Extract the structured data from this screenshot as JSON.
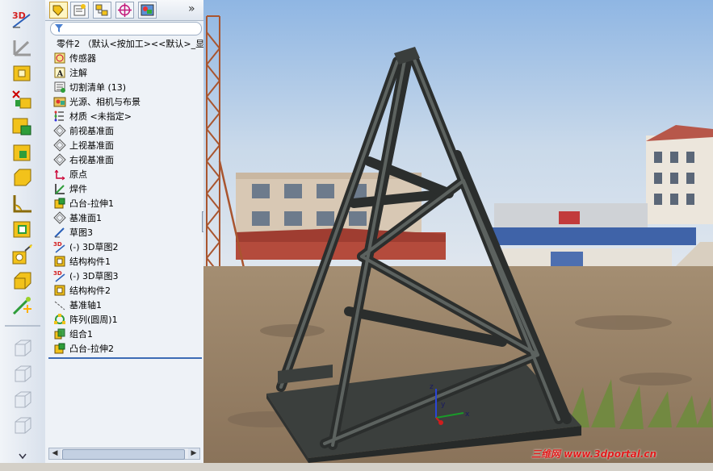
{
  "feature_tree": {
    "root": "零件2 （默认<按加工><<默认>_显",
    "items": [
      {
        "label": "传感器",
        "icon": "sensor-icon"
      },
      {
        "label": "注解",
        "icon": "annotation-icon"
      },
      {
        "label": "切割清单 (13)",
        "icon": "cut-list-icon"
      },
      {
        "label": "光源、相机与布景",
        "icon": "lights-camera-scene-icon"
      },
      {
        "label": "材质 <未指定>",
        "icon": "material-icon"
      },
      {
        "label": "前视基准面",
        "icon": "plane-icon"
      },
      {
        "label": "上视基准面",
        "icon": "plane-icon"
      },
      {
        "label": "右视基准面",
        "icon": "plane-icon"
      },
      {
        "label": "原点",
        "icon": "origin-icon"
      },
      {
        "label": "焊件",
        "icon": "weldment-icon"
      },
      {
        "label": "凸台-拉伸1",
        "icon": "boss-extrude-icon"
      },
      {
        "label": "基准面1",
        "icon": "plane-icon"
      },
      {
        "label": "草图3",
        "icon": "sketch-icon"
      },
      {
        "label": "(-) 3D草图2",
        "icon": "3d-sketch-icon"
      },
      {
        "label": "结构构件1",
        "icon": "structural-member-icon"
      },
      {
        "label": "(-) 3D草图3",
        "icon": "3d-sketch-icon"
      },
      {
        "label": "结构构件2",
        "icon": "structural-member-icon"
      },
      {
        "label": "基准轴1",
        "icon": "axis-icon"
      },
      {
        "label": "阵列(圆周)1",
        "icon": "circular-pattern-icon"
      },
      {
        "label": "组合1",
        "icon": "combine-icon"
      },
      {
        "label": "凸台-拉伸2",
        "icon": "boss-extrude-icon"
      }
    ]
  },
  "toolbar": {
    "sketch3d_label": "3D",
    "more_tabs": "»"
  },
  "triad": {
    "x": "x",
    "y": "y",
    "z": "z"
  },
  "watermark": "三维网 www.3dportal.cn",
  "colors": {
    "panel_bg": "#eef2f7",
    "selection_bar": "#3d6bb5",
    "model_steel": "#3b3f3d",
    "sky_top": "#8fb6e3"
  }
}
